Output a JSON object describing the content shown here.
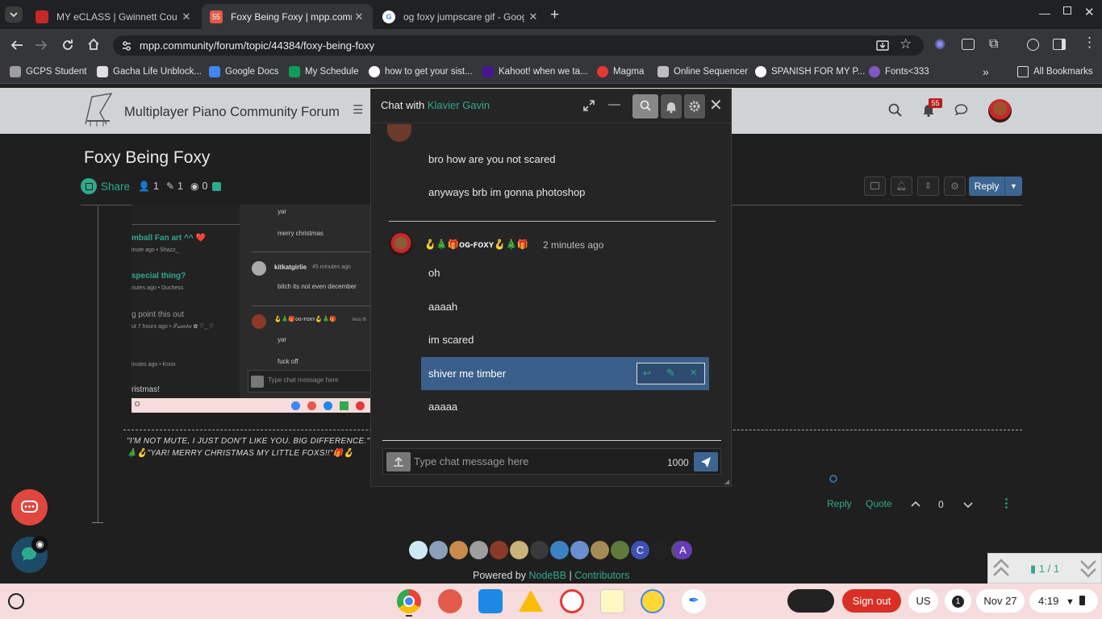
{
  "browser": {
    "tabs": [
      {
        "title": "MY eCLASS | Gwinnett County P",
        "favicon_color": "#c62828",
        "active": false
      },
      {
        "title": "Foxy Being Foxy | mpp.commun",
        "favicon_color": "#e25b4a",
        "badge": "55",
        "active": true
      },
      {
        "title": "og foxy jumpscare gif - Google",
        "favicon_color": "#4285f4",
        "active": false
      }
    ],
    "new_tab": "+",
    "url": "mpp.community/forum/topic/44384/foxy-being-foxy",
    "bookmarks": [
      {
        "label": "GCPS Student",
        "color": "#9e9e9e"
      },
      {
        "label": "Gacha Life Unblock...",
        "color": "#e0e0e0"
      },
      {
        "label": "Google Docs",
        "color": "#4285f4"
      },
      {
        "label": "My Schedule",
        "color": "#0f9d58"
      },
      {
        "label": "how to get your sist...",
        "color": "#ffffff"
      },
      {
        "label": "Kahoot! when we ta...",
        "color": "#46178f"
      },
      {
        "label": "Magma",
        "color": "#e53935"
      },
      {
        "label": "Online Sequencer",
        "color": "#bdbdbd"
      },
      {
        "label": "SPANISH FOR MY P...",
        "color": "#ffffff"
      },
      {
        "label": "Fonts<333",
        "color": "#7e57c2"
      }
    ],
    "all_bookmarks": "All Bookmarks"
  },
  "site": {
    "brand": "Multiplayer Piano Community Forum",
    "notif_count": "55",
    "topic": {
      "title": "Foxy Being Foxy",
      "share": "Share",
      "posters": "1",
      "posts": "1",
      "views": "0"
    },
    "reply_label": "Reply",
    "signature": {
      "line1": "\"I'M NOT MUTE, I JUST DON'T LIKE YOU. BIG DIFFERENCE.\"",
      "line2": "🎄🪝\"YAR! MERRY CHRISTMAS MY LITTLE FOXS!!\"🎁🪝"
    },
    "post_actions": {
      "reply": "Reply",
      "quote": "Quote",
      "votes": "0"
    },
    "footer": {
      "powered": "Powered by",
      "nodebb": "NodeBB",
      "sep": "|",
      "contributors": "Contributors",
      "avatar_letters": [
        "C",
        "A"
      ]
    },
    "pagination": "1 / 1"
  },
  "embedded_screenshot": {
    "left_items": [
      {
        "title": "mball Fan art ^^ ❤️",
        "sub": "inute ago • Shazz_"
      },
      {
        "title": "special thing?",
        "sub": "nutes ago • Duchess"
      },
      {
        "title": "g point this out",
        "sub": "ut 7 hours ago • 𝒮𝓌𝑒𝑒𝓉𝒾𝑒 ✿ ♡‿♡"
      },
      {
        "title": "",
        "sub": "inutes ago • Knox"
      },
      {
        "title": "ristmas!",
        "sub": ""
      }
    ],
    "msgs": [
      "yar",
      "merry christmas"
    ],
    "user1": "kitkatgirlie",
    "user1_time": "45 minutes ago",
    "user1_msg": "bitch its not even december",
    "user2": "🪝🎄🎁ᴏɢ-ꜰᴏxʏ🪝🎄🎁",
    "user2_time": "less th",
    "user2_msgs": [
      "yar",
      "fuck off"
    ],
    "input_placeholder": "Type chat message here",
    "taskbar_text": "O"
  },
  "chat": {
    "title_prefix": "Chat with",
    "partner": "Klavier Gavin",
    "earlier_messages": [
      "bro how are you not scared",
      "anyways brb im gonna photoshop"
    ],
    "sender": "🪝🎄🎁ᴏɢ-ꜰᴏxʏ🪝🎄🎁",
    "time": "2 minutes ago",
    "messages": [
      "oh",
      "aaaah",
      "im scared",
      "shiver me timber",
      "aaaaa"
    ],
    "input_placeholder": "Type chat message here",
    "char_count": "1000"
  },
  "shelf": {
    "sign_out": "Sign out",
    "ime": "US",
    "notif": "1",
    "date": "Nov 27",
    "time": "4:19"
  },
  "colors": {
    "accent": "#2fa98b",
    "chat_highlight": "#3a5f8a",
    "reply_button": "#3c6591",
    "fab_red": "#e0473e"
  }
}
